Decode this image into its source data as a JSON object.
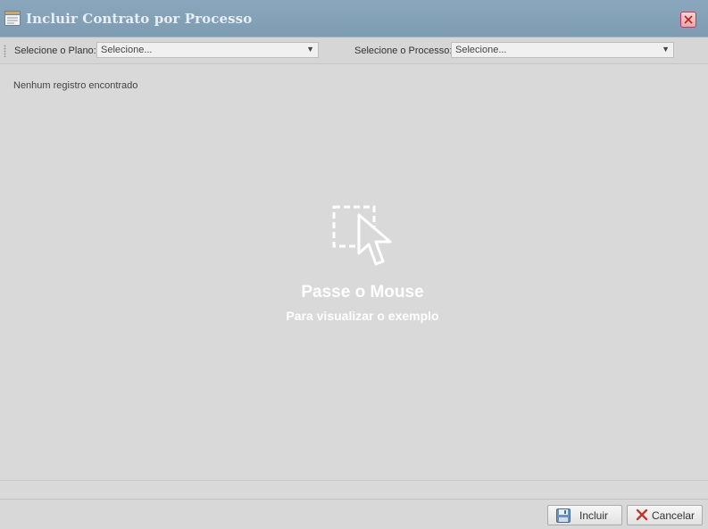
{
  "window": {
    "title": "Incluir Contrato por Processo"
  },
  "toolbar": {
    "plano_label": "Selecione o Plano:",
    "plano_value": "Selecione...",
    "processo_label": "Selecione o Processo:",
    "processo_value": "Selecione..."
  },
  "grid": {
    "empty_message": "Nenhum registro encontrado"
  },
  "hover_hint": {
    "title": "Passe o Mouse",
    "subtitle": "Para visualizar o exemplo"
  },
  "footer": {
    "incluir_label": "Incluir",
    "cancelar_label": "Cancelar"
  },
  "colors": {
    "titlebar": "#8aa7bd",
    "background": "#d9d9d9",
    "cancel_icon": "#c0392b",
    "save_icon": "#5b7fa6"
  }
}
